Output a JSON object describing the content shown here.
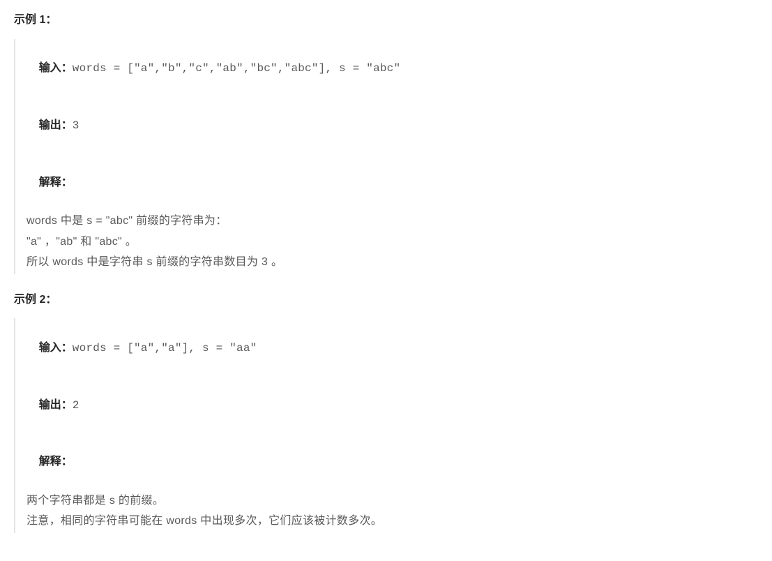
{
  "examples": [
    {
      "heading": "示例 1：",
      "input_label": "输入：",
      "input_value": "words = [\"a\",\"b\",\"c\",\"ab\",\"bc\",\"abc\"], s = \"abc\"",
      "output_label": "输出：",
      "output_value": "3",
      "explain_label": "解释：",
      "explain_lines": [
        "words 中是 s = \"abc\" 前缀的字符串为：",
        "\"a\" ，\"ab\" 和 \"abc\" 。",
        "所以 words 中是字符串 s 前缀的字符串数目为 3 。"
      ]
    },
    {
      "heading": "示例 2：",
      "input_label": "输入：",
      "input_value": "words = [\"a\",\"a\"], s = \"aa\"",
      "output_label": "输出：",
      "output_value": "2",
      "explain_label": "解释：",
      "explain_lines": [
        "两个字符串都是 s 的前缀。",
        "注意，相同的字符串可能在 words 中出现多次，它们应该被计数多次。"
      ]
    }
  ]
}
